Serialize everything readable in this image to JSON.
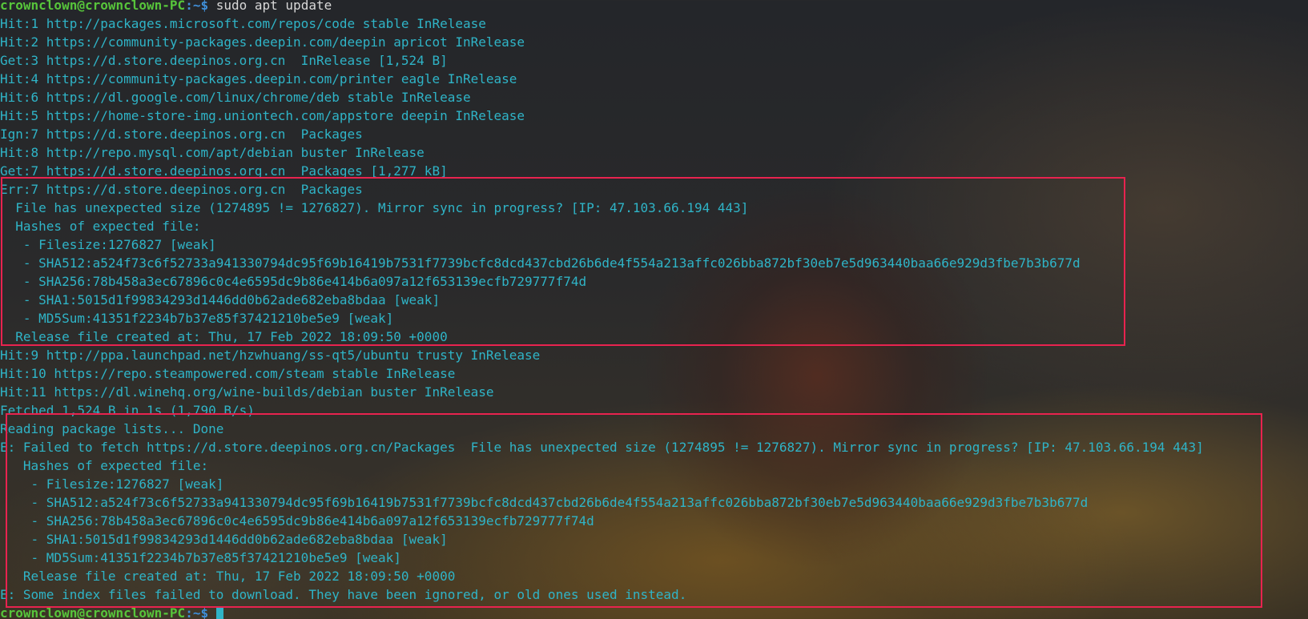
{
  "terminal": {
    "prompt": {
      "user_host": "crownclown@crownclown-PC",
      "path": ":~$",
      "command": " sudo apt update"
    },
    "output_lines": [
      "Hit:1 http://packages.microsoft.com/repos/code stable InRelease",
      "Hit:2 https://community-packages.deepin.com/deepin apricot InRelease",
      "Get:3 https://d.store.deepinos.org.cn  InRelease [1,524 B]",
      "Hit:4 https://community-packages.deepin.com/printer eagle InRelease",
      "Hit:6 https://dl.google.com/linux/chrome/deb stable InRelease",
      "Hit:5 https://home-store-img.uniontech.com/appstore deepin InRelease",
      "Ign:7 https://d.store.deepinos.org.cn  Packages",
      "Hit:8 http://repo.mysql.com/apt/debian buster InRelease",
      "Get:7 https://d.store.deepinos.org.cn  Packages [1,277 kB]",
      "Err:7 https://d.store.deepinos.org.cn  Packages",
      "  File has unexpected size (1274895 != 1276827). Mirror sync in progress? [IP: 47.103.66.194 443]",
      "  Hashes of expected file:",
      "   - Filesize:1276827 [weak]",
      "   - SHA512:a524f73c6f52733a941330794dc95f69b16419b7531f7739bcfc8dcd437cbd26b6de4f554a213affc026bba872bf30eb7e5d963440baa66e929d3fbe7b3b677d",
      "   - SHA256:78b458a3ec67896c0c4e6595dc9b86e414b6a097a12f653139ecfb729777f74d",
      "   - SHA1:5015d1f99834293d1446dd0b62ade682eba8bdaa [weak]",
      "   - MD5Sum:41351f2234b7b37e85f37421210be5e9 [weak]",
      "  Release file created at: Thu, 17 Feb 2022 18:09:50 +0000",
      "Hit:9 http://ppa.launchpad.net/hzwhuang/ss-qt5/ubuntu trusty InRelease",
      "Hit:10 https://repo.steampowered.com/steam stable InRelease",
      "Hit:11 https://dl.winehq.org/wine-builds/debian buster InRelease",
      "Fetched 1,524 B in 1s (1,790 B/s)",
      "Reading package lists... Done",
      "E: Failed to fetch https://d.store.deepinos.org.cn/Packages  File has unexpected size (1274895 != 1276827). Mirror sync in progress? [IP: 47.103.66.194 443]",
      "   Hashes of expected file:",
      "    - Filesize:1276827 [weak]",
      "    - SHA512:a524f73c6f52733a941330794dc95f69b16419b7531f7739bcfc8dcd437cbd26b6de4f554a213affc026bba872bf30eb7e5d963440baa66e929d3fbe7b3b677d",
      "    - SHA256:78b458a3ec67896c0c4e6595dc9b86e414b6a097a12f653139ecfb729777f74d",
      "    - SHA1:5015d1f99834293d1446dd0b62ade682eba8bdaa [weak]",
      "    - MD5Sum:41351f2234b7b37e85f37421210be5e9 [weak]",
      "   Release file created at: Thu, 17 Feb 2022 18:09:50 +0000",
      "E: Some index files failed to download. They have been ignored, or old ones used instead."
    ],
    "final_prompt": {
      "user_host": "crownclown@crownclown-PC",
      "path": ":~$",
      "command": " "
    }
  },
  "colors": {
    "output_text": "#2fb4c7",
    "prompt_user": "#57c53b",
    "prompt_path": "#3f8ed8",
    "command_text": "#d8d8d8",
    "highlight_border": "#e8234f"
  }
}
